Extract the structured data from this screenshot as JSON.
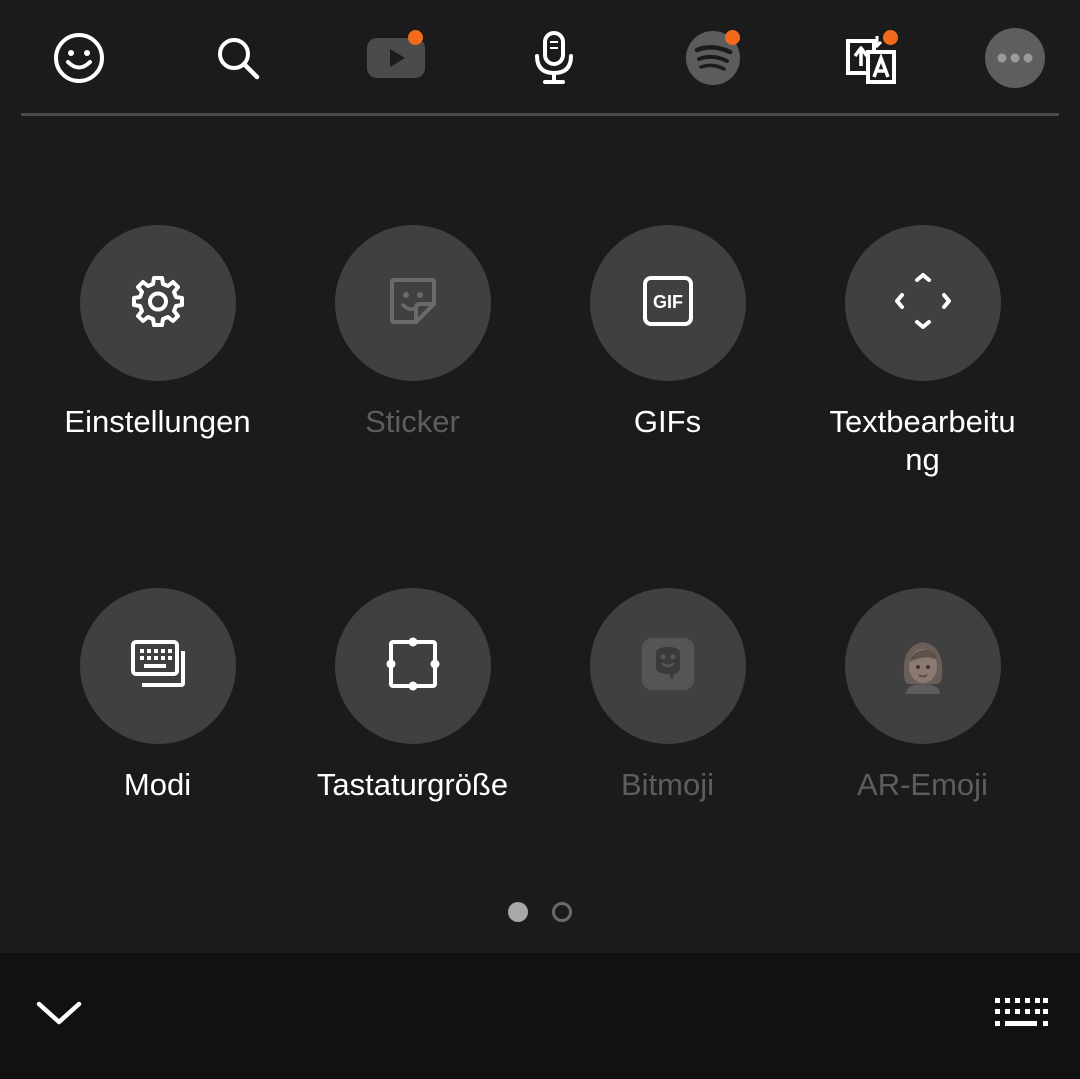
{
  "toolbar": {
    "icons": [
      {
        "name": "emoji-icon"
      },
      {
        "name": "search-icon"
      },
      {
        "name": "youtube-icon",
        "badge": true
      },
      {
        "name": "microphone-icon"
      },
      {
        "name": "spotify-icon",
        "badge": true
      },
      {
        "name": "translate-icon",
        "badge": true
      },
      {
        "name": "more-icon"
      }
    ],
    "badge_color": "#f26a1b"
  },
  "grid": {
    "items": [
      {
        "label": "Einstellungen",
        "icon": "gear-icon",
        "enabled": true
      },
      {
        "label": "Sticker",
        "icon": "sticker-icon",
        "enabled": false
      },
      {
        "label": "GIFs",
        "icon": "gif-icon",
        "enabled": true
      },
      {
        "label": "Textbearbeitung",
        "icon": "text-edit-icon",
        "enabled": true
      },
      {
        "label": "Modi",
        "icon": "keyboard-modes-icon",
        "enabled": true
      },
      {
        "label": "Tastaturgröße",
        "icon": "keyboard-size-icon",
        "enabled": true
      },
      {
        "label": "Bitmoji",
        "icon": "bitmoji-icon",
        "enabled": false
      },
      {
        "label": "AR-Emoji",
        "icon": "ar-emoji-icon",
        "enabled": false
      }
    ]
  },
  "pager": {
    "pages": 2,
    "current": 1
  },
  "bottom_bar": {
    "left_icon": "collapse-chevron-icon",
    "right_icon": "keyboard-icon"
  },
  "colors": {
    "background": "#1b1b1b",
    "tile": "#404040",
    "disabled_text": "#5d5d5d",
    "accent": "#f26a1b"
  }
}
